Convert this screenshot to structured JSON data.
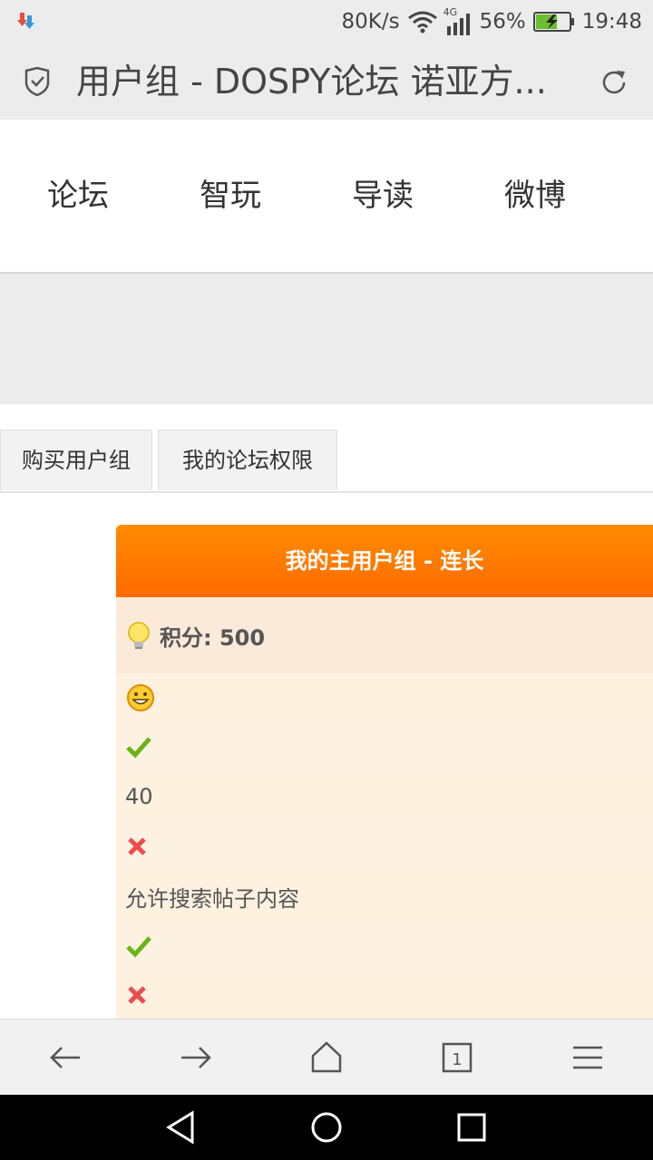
{
  "status": {
    "speed": "80K/s",
    "network": "4G",
    "battery": "56%",
    "time": "19:48"
  },
  "address": {
    "title": "用户组 - DOSPY论坛 诺亚方...",
    "icons": [
      "shield-check-icon",
      "reload-icon"
    ]
  },
  "nav": {
    "items": [
      "论坛",
      "智玩",
      "导读",
      "微博"
    ]
  },
  "tabs": [
    "购买用户组",
    "我的论坛权限"
  ],
  "card": {
    "header": "我的主用户组 - 连长",
    "points_label": "积分: 500",
    "rows": [
      {
        "type": "icon",
        "icon": "smiley-icon"
      },
      {
        "type": "icon",
        "icon": "check-icon"
      },
      {
        "type": "text",
        "text": "40"
      },
      {
        "type": "icon",
        "icon": "cross-icon"
      },
      {
        "type": "text",
        "text": "允许搜索帖子内容"
      },
      {
        "type": "icon",
        "icon": "check-icon"
      },
      {
        "type": "icon",
        "icon": "cross-icon"
      }
    ]
  },
  "colors": {
    "header_gradient_top": "#ff8c00",
    "header_gradient_bottom": "#ff6a00",
    "check": "#6ab417",
    "cross": "#ef4b4b"
  }
}
